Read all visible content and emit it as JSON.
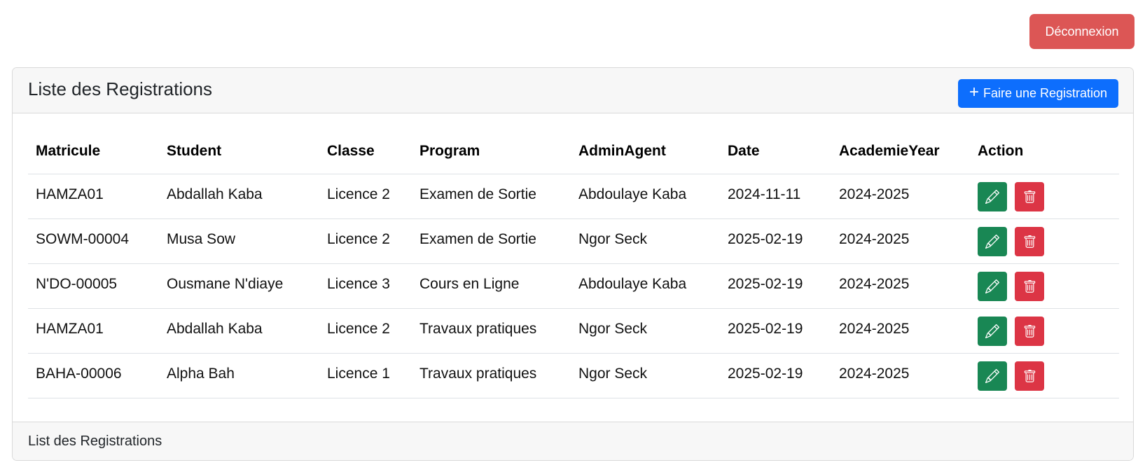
{
  "header": {
    "logout_label": "Déconnexion"
  },
  "card": {
    "title": "Liste des Registrations",
    "add_button": {
      "icon": "plus-icon",
      "label": "Faire une Registration"
    },
    "footer": "List des Registrations"
  },
  "table": {
    "columns": [
      "Matricule",
      "Student",
      "Classe",
      "Program",
      "AdminAgent",
      "Date",
      "AcademieYear",
      "Action"
    ],
    "rows": [
      [
        "HAMZA01",
        "Abdallah Kaba",
        "Licence 2",
        "Examen de Sortie",
        "Abdoulaye Kaba",
        "2024-11-11",
        "2024-2025"
      ],
      [
        "SOWM-00004",
        "Musa Sow",
        "Licence 2",
        "Examen de Sortie",
        "Ngor Seck",
        "2025-02-19",
        "2024-2025"
      ],
      [
        "N'DO-00005",
        "Ousmane N'diaye",
        "Licence 3",
        "Cours en Ligne",
        "Abdoulaye Kaba",
        "2025-02-19",
        "2024-2025"
      ],
      [
        "HAMZA01",
        "Abdallah Kaba",
        "Licence 2",
        "Travaux pratiques",
        "Ngor Seck",
        "2025-02-19",
        "2024-2025"
      ],
      [
        "BAHA-00006",
        "Alpha Bah",
        "Licence 1",
        "Travaux pratiques",
        "Ngor Seck",
        "2025-02-19",
        "2024-2025"
      ]
    ],
    "row_actions": {
      "edit_icon": "pencil-icon",
      "delete_icon": "trash-icon"
    }
  },
  "colors": {
    "logout": "#dc5655",
    "primary": "#0d6efd",
    "success": "#198754",
    "danger": "#dc3545",
    "card_header_bg": "#f7f7f7"
  }
}
